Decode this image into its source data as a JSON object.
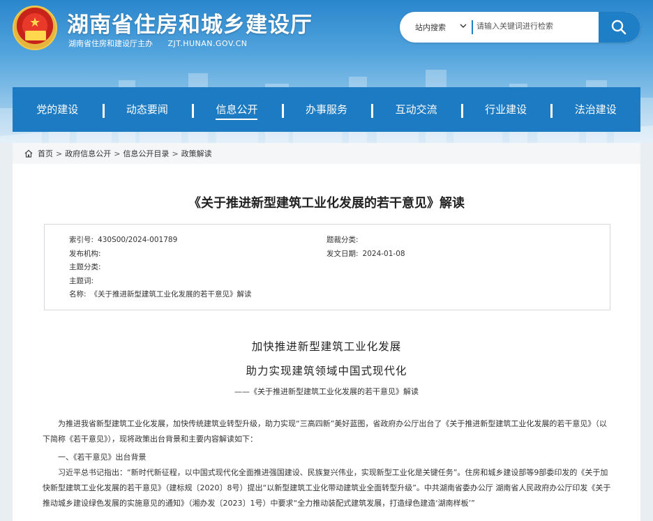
{
  "header": {
    "title": "湖南省住房和城乡建设厅",
    "subtitle": "湖南省住房和建设厅主办",
    "domain": "ZJT.HUNAN.GOV.CN"
  },
  "search": {
    "scope": "站内搜索",
    "placeholder": "请输入关键词进行检索"
  },
  "nav": {
    "items": [
      {
        "label": "党的建设"
      },
      {
        "label": "动态要闻"
      },
      {
        "label": "信息公开"
      },
      {
        "label": "办事服务"
      },
      {
        "label": "互动交流"
      },
      {
        "label": "行业建设"
      },
      {
        "label": "法治建设"
      }
    ]
  },
  "breadcrumb": {
    "items": [
      "首页",
      "政府信息公开",
      "信息公开目录",
      "政策解读"
    ]
  },
  "article": {
    "title": "《关于推进新型建筑工业化发展的若干意见》解读",
    "meta": {
      "index_label": "索引号:",
      "index_value": "430S00/2024-001789",
      "topic_label": "题裁分类:",
      "topic_value": "",
      "org_label": "发布机构:",
      "org_value": "",
      "date_label": "发文日期:",
      "date_value": "2024-01-08",
      "theme_label": "主题分类:",
      "theme_value": "",
      "keywords_label": "主题词:",
      "keywords_value": "",
      "name_label": "名称:",
      "name_value": "《关于推进新型建筑工业化发展的若干意见》解读"
    },
    "heading1": "加快推进新型建筑工业化发展",
    "heading2": "助力实现建筑领域中国式现代化",
    "caption": "——《关于推进新型建筑工业化发展的若干意见》解读",
    "paragraphs": [
      "为推进我省新型建筑工业化发展，加快传统建筑业转型升级，助力实现“三高四新”美好蓝图，省政府办公厅出台了《关于推进新型建筑工业化发展的若干意见》（以下简称《若干意见》），现将政策出台背景和主要内容解读如下：",
      "一、《若干意见》出台背景",
      "习近平总书记指出：“新时代新征程，以中国式现代化全面推进强国建设、民族复兴伟业，实现新型工业化是关键任务”。住房和城乡建设部等9部委印发的《关于加快新型建筑工业化发展的若干意见》（建标规〔2020〕8号）提出“以新型建筑工业化带动建筑业全面转型升级”。中共湖南省委办公厅 湖南省人民政府办公厅印发《关于推动城乡建设绿色发展的实施意见的通知》（湘办发〔2023〕1号）中要求“全力推动装配式建筑发展，打造绿色建造‘湖南样板’”"
    ]
  }
}
